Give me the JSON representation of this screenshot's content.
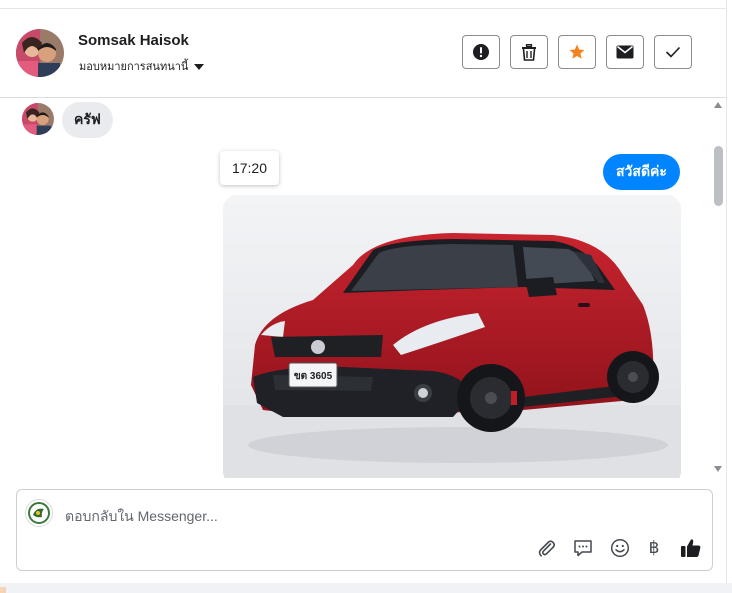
{
  "header": {
    "contact_name": "Somsak Haisok",
    "assign_label": "มอบหมายการสนทนานี้",
    "tools": [
      {
        "name": "mark-spam",
        "icon": "exclamation-circle-icon"
      },
      {
        "name": "delete",
        "icon": "trash-icon"
      },
      {
        "name": "star",
        "icon": "star-icon",
        "active_color": "#f5821f"
      },
      {
        "name": "mark-unread",
        "icon": "envelope-icon"
      },
      {
        "name": "mark-done",
        "icon": "checkmark-icon"
      }
    ]
  },
  "messages": {
    "incoming_text": "ครัฟ",
    "timestamp": "17:20",
    "outgoing_text": "สวัสดีค่ะ",
    "outgoing_color": "#0084ff",
    "photo": {
      "subject": "red hatchback car",
      "plate": "ขต 3605"
    }
  },
  "composer": {
    "placeholder": "ตอบกลับใน Messenger...",
    "icons": [
      "paperclip-icon",
      "saved-reply-icon",
      "emoji-icon",
      "baht-icon",
      "thumbs-up-icon"
    ],
    "baht_symbol": "฿"
  }
}
